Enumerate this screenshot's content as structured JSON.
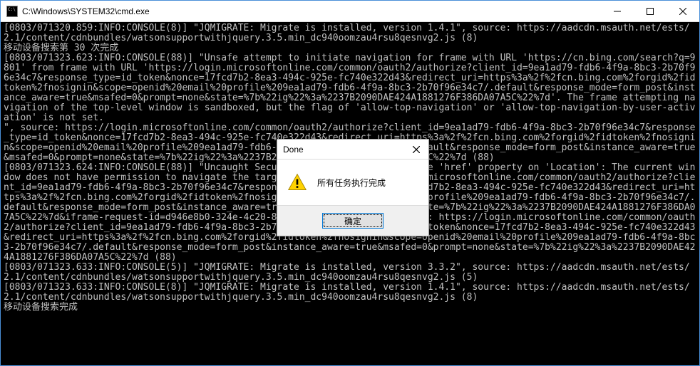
{
  "window": {
    "title": "C:\\Windows\\SYSTEM32\\cmd.exe"
  },
  "console_lines": [
    "[0803/071320.859:INFO:CONSOLE(8)] \"JQMIGRATE: Migrate is installed, version 1.4.1\", source: https://aadcdn.msauth.net/ests/2.1/content/cdnbundles/watsonsupportwithjquery.3.5.min_dc940oomzau4rsu8qesnvg2.js (8)",
    "移动设备搜索第 30 次完成",
    "[0803/071323.623:INFO:CONSOLE(88)] \"Unsafe attempt to initiate navigation for frame with URL 'https://cn.bing.com/search?q=9801' from frame with URL 'https://login.microsoftonline.com/common/oauth2/authorize?client_id=9ea1ad79-fdb6-4f9a-8bc3-2b70f96e34c7&response_type=id_token&nonce=17fcd7b2-8ea3-494c-925e-fc740e322d43&redirect_uri=https%3a%2f%2fcn.bing.com%2forgid%2fidtoken%2fnosignin&scope=openid%20email%20profile%209ea1ad79-fdb6-4f9a-8bc3-2b70f96e34c7/.default&response_mode=form_post&instance_aware=true&msafed=0&prompt=none&state=%7b%22ig%22%3a%2237B2090DAE424A1881276F386DA07A5C%22%7d'. The frame attempting navigation of the top-level window is sandboxed, but the flag of 'allow-top-navigation' or 'allow-top-navigation-by-user-activation' is not set.",
    "\", source: https://login.microsoftonline.com/common/oauth2/authorize?client_id=9ea1ad79-fdb6-4f9a-8bc3-2b70f96e34c7&response_type=id_token&nonce=17fcd7b2-8ea3-494c-925e-fc740e322d43&redirect_uri=https%3a%2f%2fcn.bing.com%2forgid%2fidtoken%2fnosignin&scope=openid%20email%20profile%209ea1ad79-fdb6-4f9a-8bc3-2b70f96e34c7/.default&response_mode=form_post&instance_aware=true&msafed=0&prompt=none&state=%7b%22ig%22%3a%2237B2090DAE424A1881276F386DA07A5C%22%7d (88)",
    "[0803/071323.624:INFO:CONSOLE(88)] \"Uncaught SecurityError: Failed to set the 'href' property on 'Location': The current window does not have permission to navigate the target frame to 'https://login.microsoftonline.com/common/oauth2/authorize?client_id=9ea1ad79-fdb6-4f9a-8bc3-2b70f96e34c7&response_type=id_token&nonce=17fcd7b2-8ea3-494c-925e-fc740e322d43&redirect_uri=https%3a%2f%2fcn.bing.com%2forgid%2fidtoken%2fnosignin&scope=openid%20email%20profile%209ea1ad79-fdb6-4f9a-8bc3-2b70f96e34c7/.default&response_mode=form_post&instance_aware=true&msafed=0&prompt=none&state=%7b%22ig%22%3a%2237B2090DAE424A1881276F386DA07A5C%22%7d&iframe-request-id=d946e8b0-324e-4c20-8f1d-92a0ec394600'.\", source: https://login.microsoftonline.com/common/oauth2/authorize?client_id=9ea1ad79-fdb6-4f9a-8bc3-2b70f96e34c7&response_type=id_token&nonce=17fcd7b2-8ea3-494c-925e-fc740e322d43&redirect_uri=https%3a%2f%2fcn.bing.com%2forgid%2fidtoken%2fnosignin&scope=openid%20email%20profile%209ea1ad79-fdb6-4f9a-8bc3-2b70f96e34c7/.default&response_mode=form_post&instance_aware=true&msafed=0&prompt=none&state=%7b%22ig%22%3a%2237B2090DAE424A1881276F386DA07A5C%22%7d (88)",
    "[0803/071323.633:INFO:CONSOLE(5)] \"JQMIGRATE: Migrate is installed, version 3.3.2\", source: https://aadcdn.msauth.net/ests/2.1/content/cdnbundles/watsonsupportwithjquery.3.5.min_dc940oomzau4rsu8qesnvg2.js (5)",
    "[0803/071323.633:INFO:CONSOLE(8)] \"JQMIGRATE: Migrate is installed, version 1.4.1\", source: https://aadcdn.msauth.net/ests/2.1/content/cdnbundles/watsonsupportwithjquery.3.5.min_dc940oomzau4rsu8qesnvg2.js (8)",
    "移动设备搜索完成"
  ],
  "dialog": {
    "title": "Done",
    "message": "所有任务执行完成",
    "ok_label": "确定"
  },
  "icons": {
    "minimize": "minimize-icon",
    "maximize": "maximize-icon",
    "close": "close-icon",
    "warning": "warning-icon",
    "app": "cmd-icon"
  }
}
